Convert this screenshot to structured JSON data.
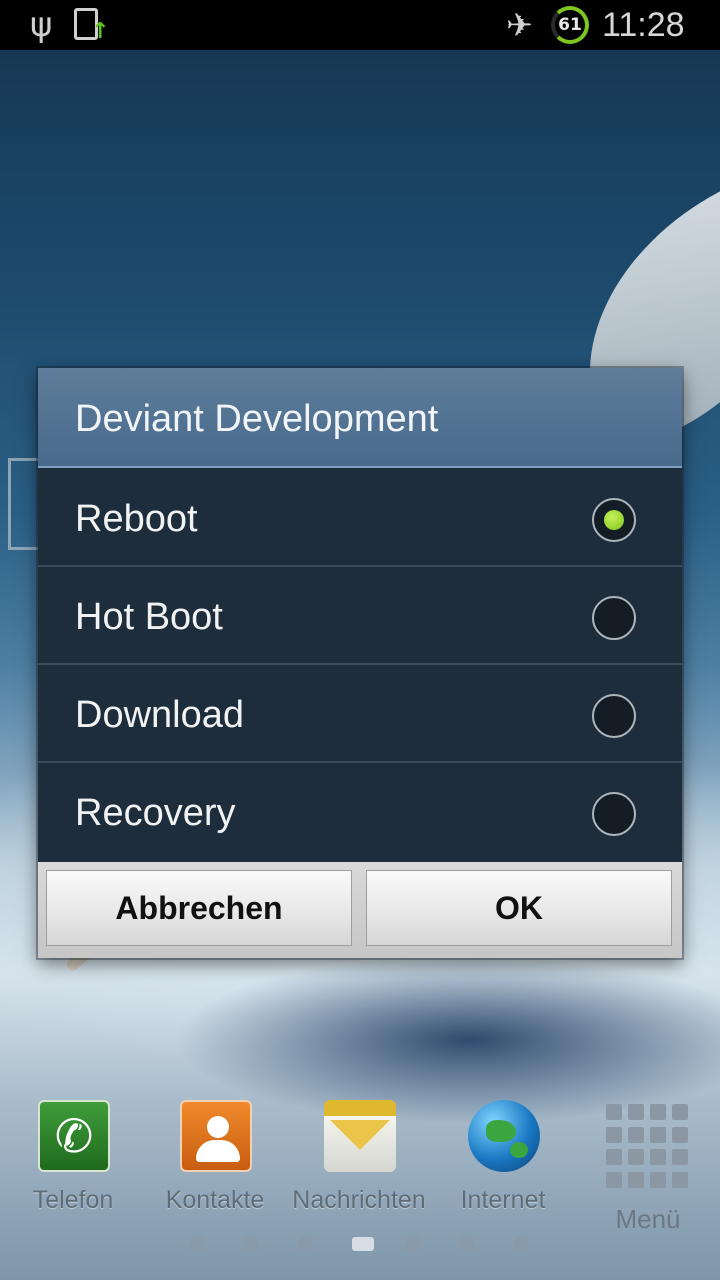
{
  "status_bar": {
    "icons": [
      "usb-icon",
      "sync-icon",
      "airplane-mode-icon"
    ],
    "battery_level": "61",
    "time": "11:28"
  },
  "dialog": {
    "title": "Deviant Development",
    "options": [
      {
        "label": "Reboot",
        "selected": true
      },
      {
        "label": "Hot Boot",
        "selected": false
      },
      {
        "label": "Download",
        "selected": false
      },
      {
        "label": "Recovery",
        "selected": false
      }
    ],
    "cancel_label": "Abbrechen",
    "ok_label": "OK",
    "accent_color": "#7dc41a"
  },
  "dock": {
    "items": [
      {
        "label": "Telefon",
        "icon": "phone-icon"
      },
      {
        "label": "Kontakte",
        "icon": "contacts-icon"
      },
      {
        "label": "Nachrichten",
        "icon": "messages-icon"
      },
      {
        "label": "Internet",
        "icon": "internet-globe-icon"
      }
    ],
    "menu_label": "Menü",
    "page_count": 7,
    "active_page": 4
  }
}
